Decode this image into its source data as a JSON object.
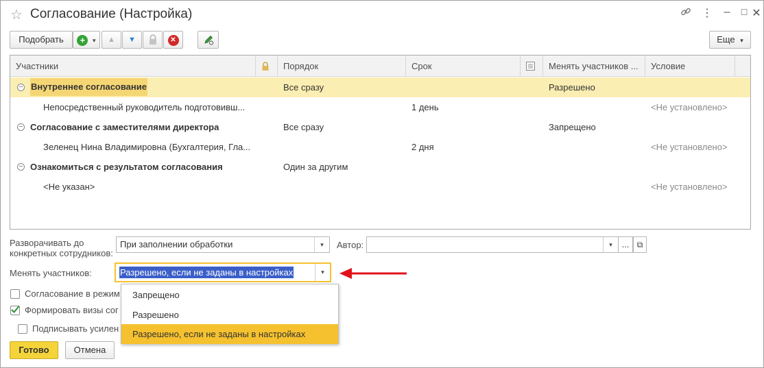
{
  "window": {
    "title": "Согласование (Настройка)",
    "controls": {
      "link": "🔗",
      "menu": "⋮",
      "minimize": "–",
      "maximize": "□",
      "close": "✕"
    }
  },
  "toolbar": {
    "pick_label": "Подобрать",
    "more_label": "Еще",
    "add_icon": "+",
    "up_icon": "▲",
    "down_icon": "▼",
    "delete_icon": "✕",
    "dropdown_caret": "▾"
  },
  "grid": {
    "columns": [
      "Участники",
      "Порядок",
      "Срок",
      "Менять участников ...",
      "Условие"
    ],
    "rows": [
      {
        "participant": "Внутреннее согласование",
        "order": "Все сразу",
        "term": "",
        "change": "Разрешено",
        "condition": ""
      },
      {
        "participant": "Непосредственный руководитель подготовивш...",
        "order": "",
        "term": "1 день",
        "change": "",
        "condition": "<Не установлено>"
      },
      {
        "participant": "Согласование с заместителями директора",
        "order": "Все сразу",
        "term": "",
        "change": "Запрещено",
        "condition": ""
      },
      {
        "participant": "Зеленец Нина Владимировна (Бухгалтерия, Гла...",
        "order": "",
        "term": "2 дня",
        "change": "",
        "condition": "<Не установлено>"
      },
      {
        "participant": "Ознакомиться с результатом согласования",
        "order": "Один за другим",
        "term": "",
        "change": "",
        "condition": ""
      },
      {
        "participant": "<Не указан>",
        "order": "",
        "term": "",
        "change": "",
        "condition": "<Не установлено>"
      }
    ]
  },
  "form": {
    "expand_label_1": "Разворачивать до",
    "expand_label_2": "конкретных сотрудников:",
    "expand_value": "При заполнении обработки",
    "author_label": "Автор:",
    "author_value": "",
    "change_label": "Менять участников:",
    "change_value": "Разрешено, если не заданы в настройках",
    "check1_label": "Согласование в режим",
    "check2_label": "Формировать визы сог",
    "check3_label": "Подписывать усилен",
    "ellipsis": "...",
    "open_icon": "⧉"
  },
  "dropdown": {
    "options": [
      "Запрещено",
      "Разрешено",
      "Разрешено, если не заданы в настройках"
    ]
  },
  "buttons": {
    "done": "Готово",
    "cancel": "Отмена"
  },
  "colors": {
    "accent_yellow": "#f5c12e",
    "selection_blue": "#3a5fc8",
    "arrow_red": "#e2121b"
  }
}
